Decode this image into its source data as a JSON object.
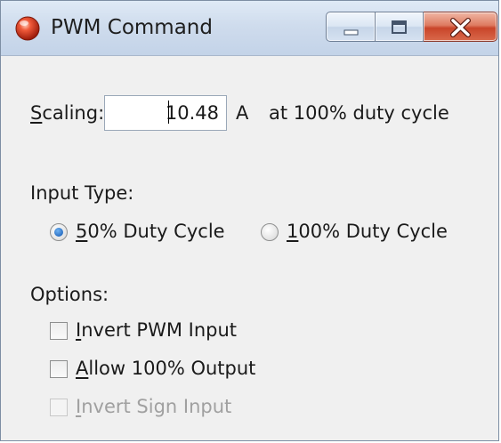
{
  "window": {
    "title": "PWM Command",
    "icon": "red-sphere-icon"
  },
  "caption_buttons": {
    "minimize": "minimize-icon",
    "maximize": "maximize-icon",
    "close": "close-icon"
  },
  "scaling": {
    "label_first": "S",
    "label_rest": "caling:",
    "value": "10.48",
    "unit": "A",
    "suffix": "at 100% duty cycle"
  },
  "input_type": {
    "label": "Input Type:",
    "options": [
      {
        "accel": "5",
        "rest": "0% Duty Cycle",
        "selected": true
      },
      {
        "accel": "1",
        "rest": "00% Duty Cycle",
        "selected": false
      }
    ]
  },
  "options": {
    "label": "Options:",
    "items": [
      {
        "accel": "I",
        "rest": "nvert PWM Input",
        "checked": false,
        "enabled": true
      },
      {
        "accel": "A",
        "rest": "llow 100% Output",
        "checked": false,
        "enabled": true
      },
      {
        "accel": "I",
        "rest": "nvert Sign Input",
        "checked": false,
        "enabled": false
      }
    ]
  },
  "colors": {
    "title_bar": "#cfdced",
    "close_button": "#c9452a",
    "radio_selected": "#2a6fc3",
    "disabled_text": "#a0a0a0"
  }
}
